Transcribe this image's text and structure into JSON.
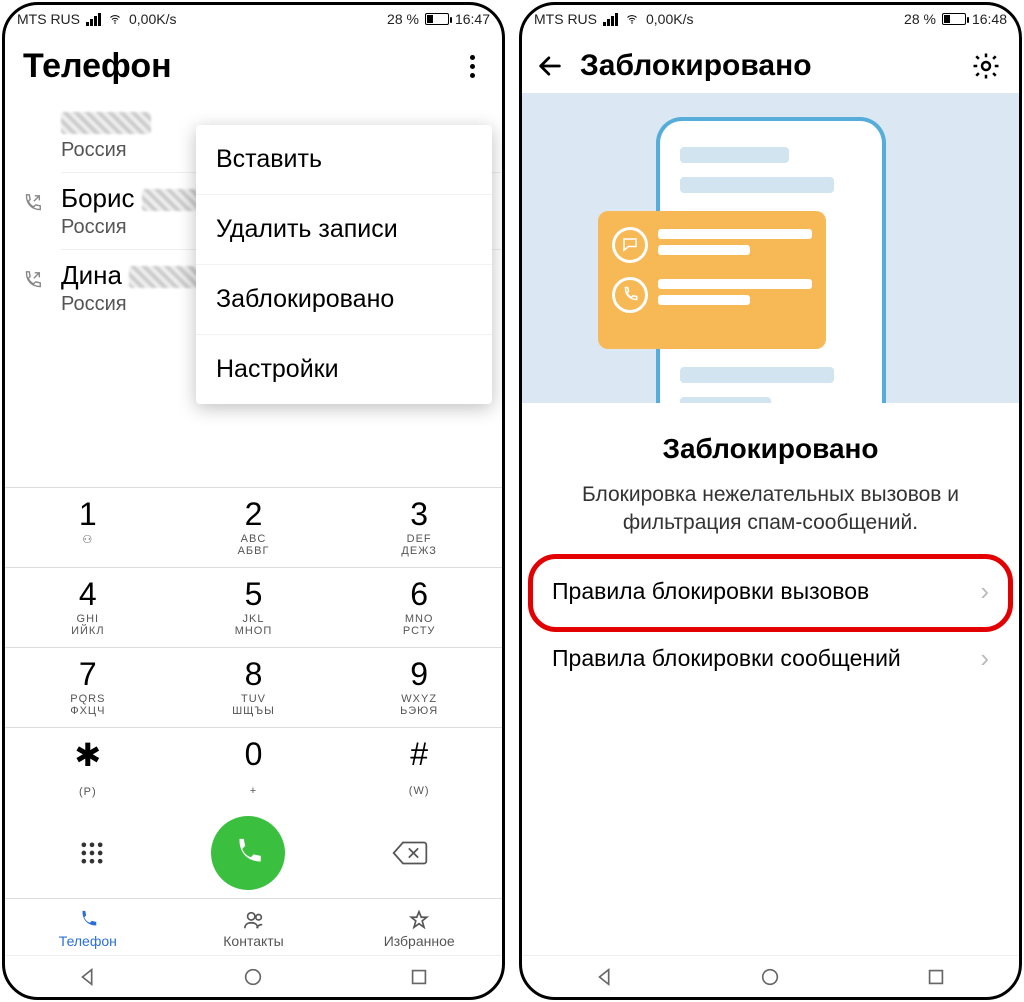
{
  "left": {
    "status": {
      "carrier": "MTS RUS",
      "speed": "0,00K/s",
      "battery": "28 %",
      "time": "16:47"
    },
    "title": "Телефон",
    "calls": [
      {
        "name": "",
        "sub": "Россия"
      },
      {
        "name": "Борис",
        "sub": "Россия"
      },
      {
        "name": "Дина",
        "sub": "Россия"
      }
    ],
    "menu": {
      "paste": "Вставить",
      "delete": "Удалить записи",
      "blocked": "Заблокировано",
      "settings": "Настройки"
    },
    "keys": [
      {
        "n": "1",
        "l1": "",
        "l2": "QO"
      },
      {
        "n": "2",
        "l1": "ABC",
        "l2": "АБВГ"
      },
      {
        "n": "3",
        "l1": "DEF",
        "l2": "ДЕЖЗ"
      },
      {
        "n": "4",
        "l1": "GHI",
        "l2": "ИЙКЛ"
      },
      {
        "n": "5",
        "l1": "JKL",
        "l2": "МНОП"
      },
      {
        "n": "6",
        "l1": "MNO",
        "l2": "РСТУ"
      },
      {
        "n": "7",
        "l1": "PQRS",
        "l2": "ФХЦЧ"
      },
      {
        "n": "8",
        "l1": "TUV",
        "l2": "ШЩЪЫ"
      },
      {
        "n": "9",
        "l1": "WXYZ",
        "l2": "ЬЭЮЯ"
      },
      {
        "n": "✱",
        "l1": "",
        "l2": "(P)"
      },
      {
        "n": "0",
        "l1": "",
        "l2": "+"
      },
      {
        "n": "#",
        "l1": "",
        "l2": "(W)"
      }
    ],
    "tabs": {
      "phone": "Телефон",
      "contacts": "Контакты",
      "fav": "Избранное"
    }
  },
  "right": {
    "status": {
      "carrier": "MTS RUS",
      "speed": "0,00K/s",
      "battery": "28 %",
      "time": "16:48"
    },
    "title": "Заблокировано",
    "section_title": "Заблокировано",
    "section_desc": "Блокировка нежелательных вызовов и фильтрация спам-сообщений.",
    "row1": "Правила блокировки вызовов",
    "row2": "Правила блокировки сообщений",
    "chev": "›"
  }
}
